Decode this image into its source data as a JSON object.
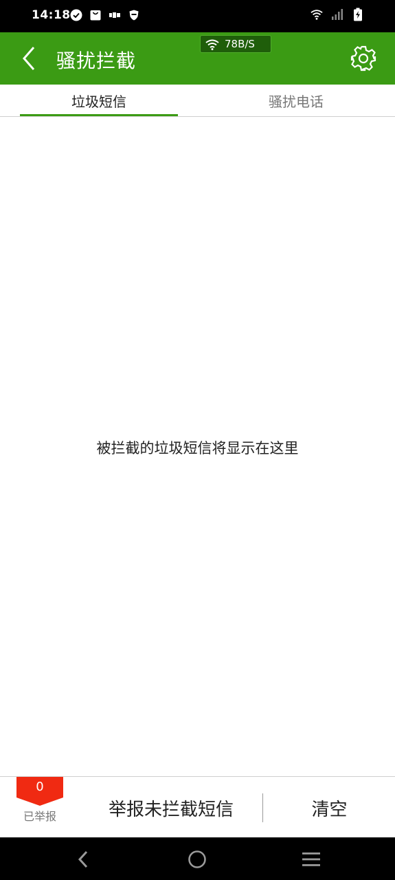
{
  "status_bar": {
    "time": "14:18",
    "icons_left": [
      "check-circle-icon",
      "bag-icon",
      "notification-text-icon",
      "shield-icon"
    ],
    "icons_right": [
      "wifi-icon",
      "cellular-signal-icon",
      "battery-charging-icon"
    ]
  },
  "app_bar": {
    "title": "骚扰拦截",
    "network_speed": "78B/S",
    "color": "#3b9b14"
  },
  "tabs": [
    {
      "label": "垃圾短信",
      "selected": true
    },
    {
      "label": "骚扰电话",
      "selected": false
    }
  ],
  "content": {
    "empty_message": "被拦截的垃圾短信将显示在这里"
  },
  "action_bar": {
    "reported_count": "0",
    "reported_label": "已举报",
    "report_button": "举报未拦截短信",
    "clear_button": "清空",
    "badge_color": "#f02a12"
  }
}
